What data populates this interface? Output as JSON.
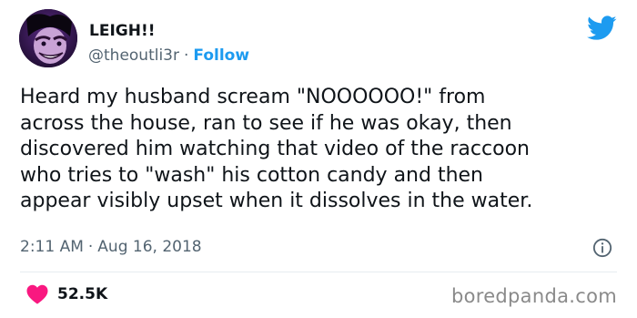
{
  "author": {
    "display_name": "LEIGH!!",
    "handle": "@theoutli3r",
    "separator": "·",
    "follow_label": "Follow"
  },
  "tweet": {
    "text_lines": [
      "Heard my husband scream \"NOOOOOO!\" from",
      "across the house, ran to see if he was okay, then",
      "discovered him watching that video of the raccoon",
      "who tries to \"wash\" his cotton candy and then",
      "appear visibly upset when it dissolves in the water."
    ],
    "time": "2:11 AM",
    "date": "Aug 16, 2018",
    "separator": "·"
  },
  "engagement": {
    "likes": "52.5K"
  },
  "watermark": "boredpanda.com",
  "icons": {
    "brand": "twitter-bird-icon",
    "info": "info-icon",
    "like": "heart-icon"
  },
  "colors": {
    "accent": "#1d9bf0",
    "like": "#f91880",
    "text": "#0f1419",
    "muted": "#536471",
    "watermark": "#8a8a8a"
  }
}
